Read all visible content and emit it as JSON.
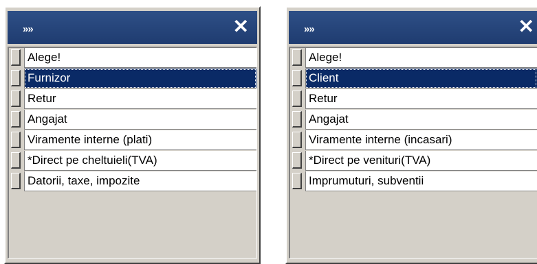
{
  "colors": {
    "titlebar": "#1f3c70",
    "selection": "#0a2a66",
    "face": "#d4d0c8"
  },
  "panels": [
    {
      "title_icon": "double-chevron-right",
      "title_glyph": "»»",
      "close_glyph": "✕",
      "selected_index": 1,
      "items": [
        "Alege!",
        "Furnizor",
        "Retur",
        "Angajat",
        "Viramente interne (plati)",
        "*Direct pe cheltuieli(TVA)",
        "Datorii, taxe, impozite"
      ]
    },
    {
      "title_icon": "double-chevron-right",
      "title_glyph": "»»",
      "close_glyph": "✕",
      "selected_index": 1,
      "items": [
        "Alege!",
        "Client",
        "Retur",
        "Angajat",
        "Viramente interne (incasari)",
        "*Direct pe venituri(TVA)",
        "Imprumuturi, subventii"
      ]
    }
  ]
}
